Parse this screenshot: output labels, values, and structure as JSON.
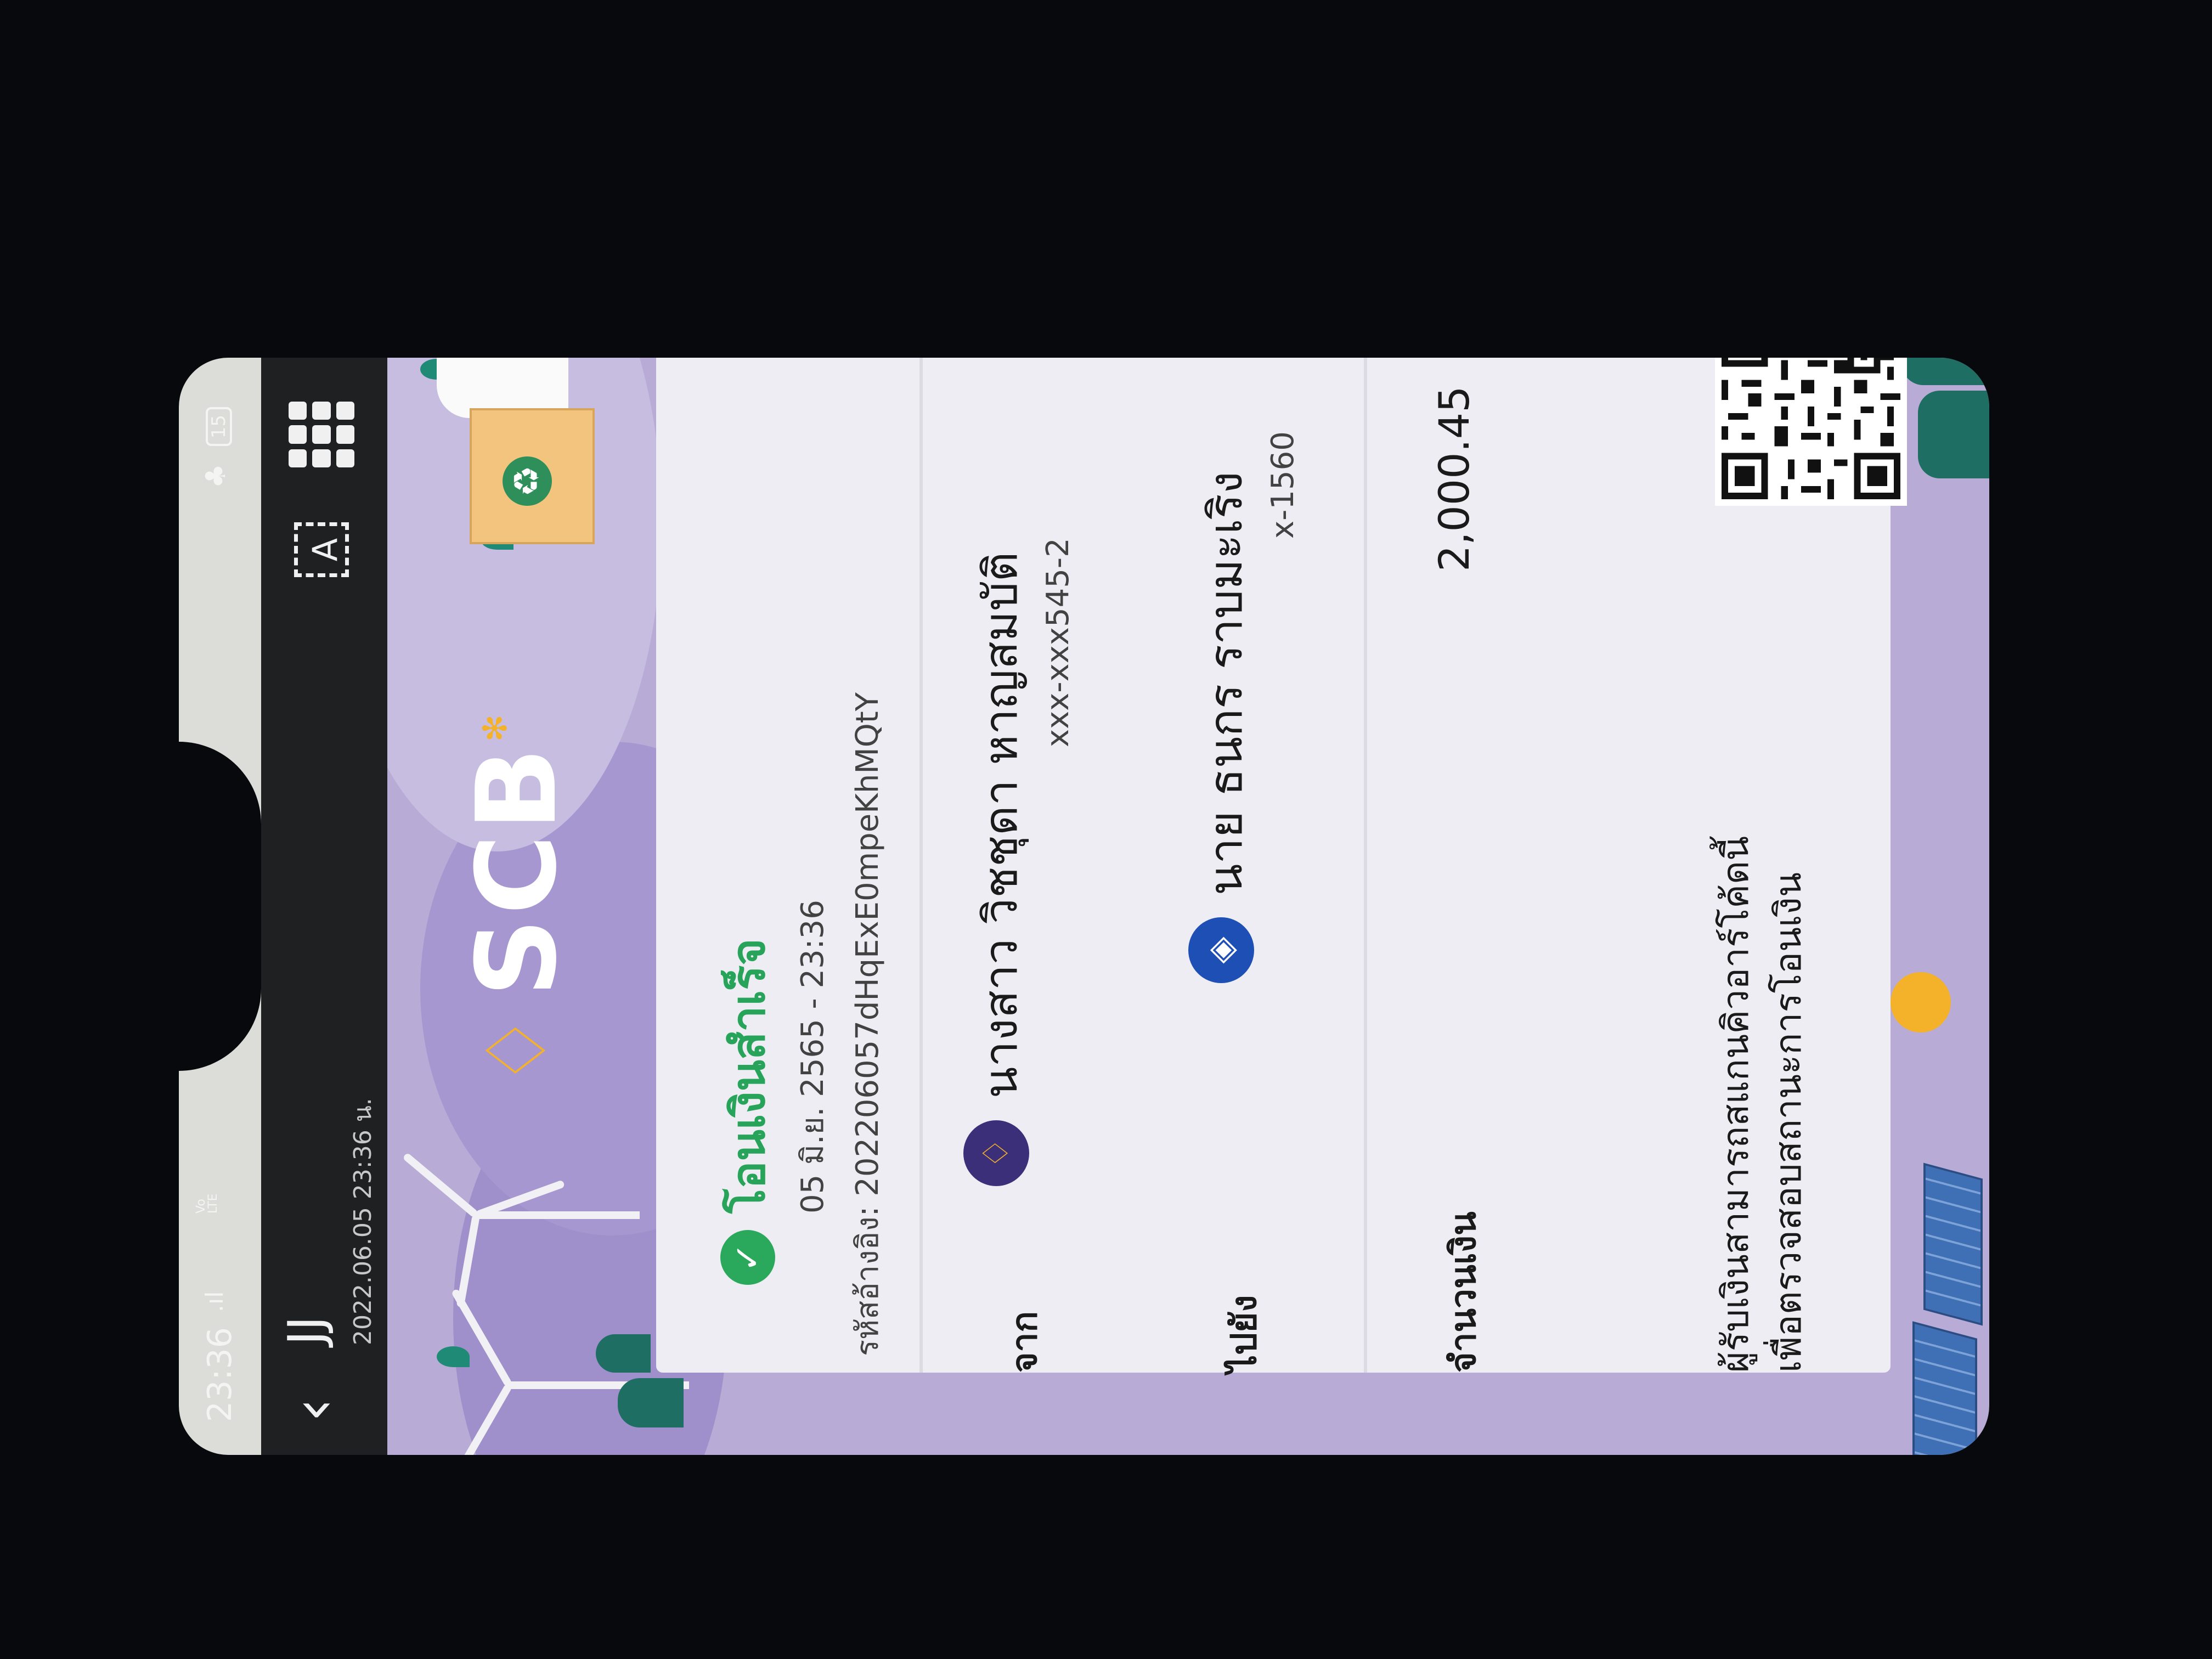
{
  "status_bar": {
    "time": "23:36",
    "signal_label": ".ıl",
    "volte_label": "Vo\nLTE",
    "battery": "15"
  },
  "app_bar": {
    "title": "JJ",
    "subtitle": "2022.06.05 23:36 น.",
    "ocr_label": "A"
  },
  "slip": {
    "brand": "SCB",
    "status_title": "โอนเงินสำเร็จ",
    "datetime": "05 มิ.ย. 2565 - 23:36",
    "reference": "รหัสอ้างอิง: 202206057dHqExE0mpeKhMQtY",
    "from_label": "จาก",
    "from_name": "นางสาว วิชชุดา หาญสมบัติ",
    "from_account": "xxx-xxx545-2",
    "to_label": "ไปยัง",
    "to_name": "นาย ธนกร ราบมะเริง",
    "to_account": "x-1560",
    "amount_label": "จำนวนเงิน",
    "amount": "2,000.45",
    "qr_note_line1": "ผู้รับเงินสามารถสแกนคิวอาร์โค้ดนี้",
    "qr_note_line2": "เพื่อตรวจสอบสถานะการโอนเงิน"
  },
  "colors": {
    "success_green": "#27a35a",
    "scb_gold": "#f4b12a",
    "card_bg": "#eeedf3",
    "slip_purple": "#b8acd6",
    "bank_from_bg": "#3b2f7a",
    "bank_to_bg": "#1e4fb5"
  },
  "icons": {
    "back": "chevron-left-icon",
    "ocr": "text-scan-icon",
    "apps": "grid-icon",
    "check": "check-circle-icon",
    "from_bank": "scb-bank-icon",
    "to_bank": "bbl-bank-icon"
  }
}
